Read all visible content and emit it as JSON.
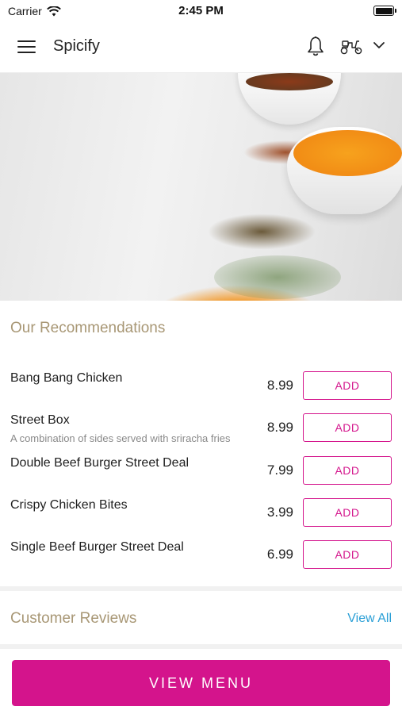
{
  "status_bar": {
    "carrier": "Carrier",
    "time": "2:45 PM",
    "battery_level": 1.0
  },
  "header": {
    "title": "Spicify",
    "icons": [
      "menu-icon",
      "bell-icon",
      "scooter-icon",
      "chevron-down-icon"
    ]
  },
  "hero": {
    "image": "spices-photo"
  },
  "recommendations": {
    "title": "Our Recommendations",
    "items": [
      {
        "name": "Bang Bang Chicken",
        "description": "",
        "price": "8.99",
        "button": "ADD"
      },
      {
        "name": "Street Box",
        "description": "A combination of sides served with sriracha fries",
        "price": "8.99",
        "button": "ADD"
      },
      {
        "name": "Double Beef Burger Street Deal",
        "description": "",
        "price": "7.99",
        "button": "ADD"
      },
      {
        "name": "Crispy Chicken Bites",
        "description": "",
        "price": "3.99",
        "button": "ADD"
      },
      {
        "name": "Single Beef Burger Street Deal",
        "description": "",
        "price": "6.99",
        "button": "ADD"
      }
    ]
  },
  "reviews": {
    "title": "Customer Reviews",
    "view_all": "View All"
  },
  "bottom": {
    "view_menu": "VIEW MENU"
  },
  "colors": {
    "accent": "#d4148c",
    "section_title": "#a89775",
    "link": "#2a9fd6"
  }
}
